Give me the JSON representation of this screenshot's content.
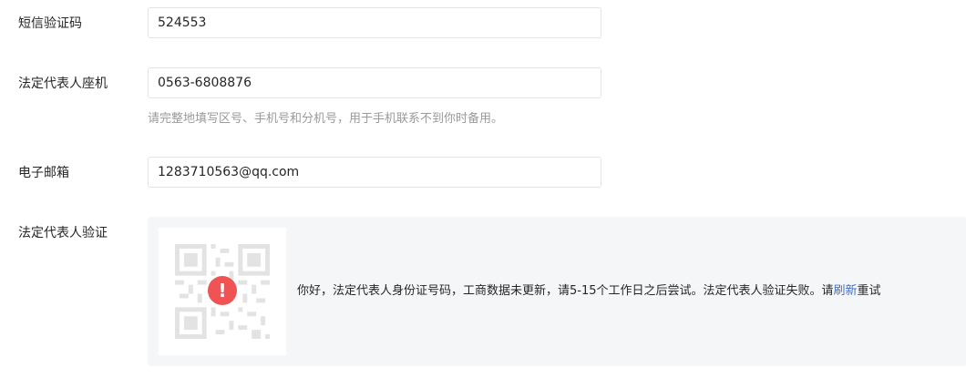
{
  "form": {
    "sms_code": {
      "label": "短信验证码",
      "value": "524553"
    },
    "landline": {
      "label": "法定代表人座机",
      "value": "0563-6808876",
      "hint": "请完整地填写区号、手机号和分机号，用于手机联系不到你时备用。"
    },
    "email": {
      "label": "电子邮箱",
      "value": "1283710563@qq.com"
    },
    "verification": {
      "label": "法定代表人验证",
      "error_icon": "!",
      "message_before": "你好，法定代表人身份证号码，工商数据未更新，请5-15个工作日之后尝试。法定代表人验证失败。请",
      "refresh_link": "刷新",
      "message_after": "重试"
    }
  },
  "colors": {
    "accent_link": "#3d6ed6",
    "error": "#f05353",
    "panel_bg": "#f5f6f8",
    "hint_text": "#9a9a9a"
  },
  "icons": [
    "qr-code-icon",
    "error-icon"
  ]
}
